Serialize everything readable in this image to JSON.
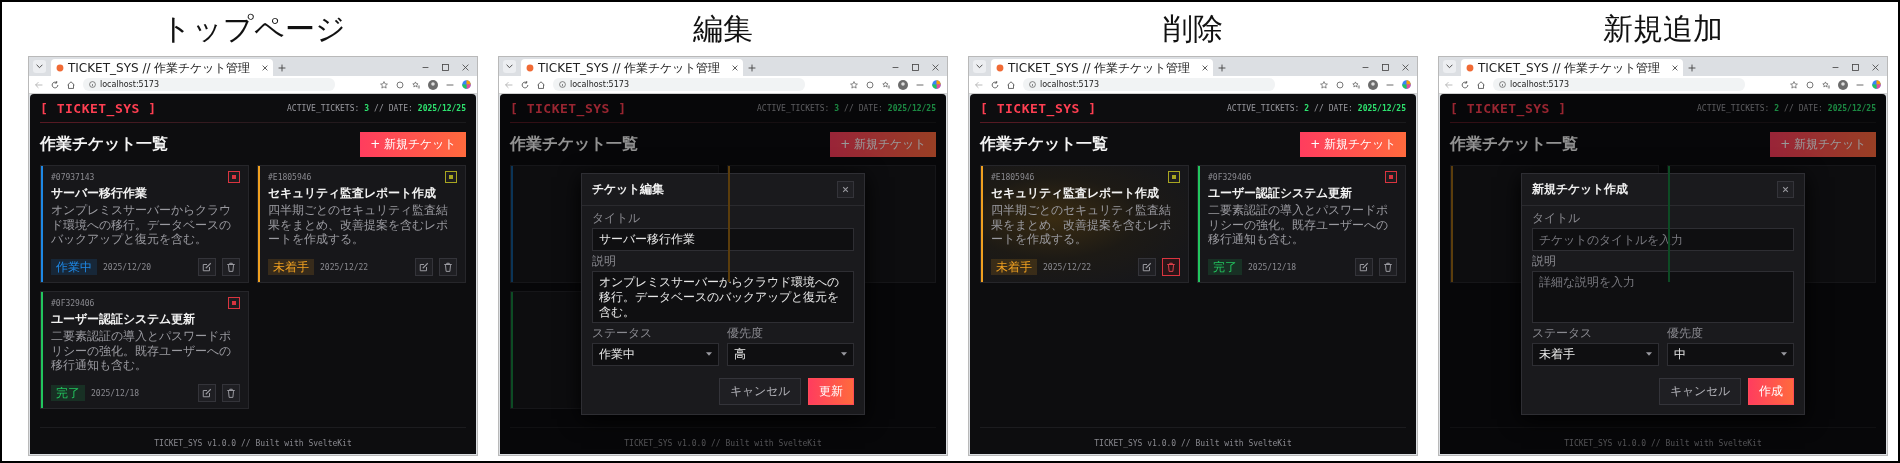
{
  "sections": [
    {
      "caption": "トップページ",
      "browser": {
        "tab_title": "TICKET_SYS // 作業チケット管理",
        "url": "localhost:5173"
      },
      "page": {
        "logo": "[ TICKET_SYS ]",
        "stats": {
          "active_label": "ACTIVE_TICKETS:",
          "active_count": "3",
          "separator": "//",
          "date_label": "DATE:",
          "date": "2025/12/25"
        },
        "heading": "作業チケット一覧",
        "new_button": "+ 新規チケット",
        "cards": [
          {
            "kind": "ticket",
            "id": "#07937143",
            "priority_marker": {
              "color": "#d9343f"
            },
            "title": "サーバー移行作業",
            "description": "オンプレミスサーバーからクラウド環境への移行。データベースのバックアップと復元を含む。",
            "status": "作業中",
            "date": "2025/12/20",
            "color": "#1e88e5",
            "hovered": false
          },
          {
            "kind": "ticket",
            "id": "#E1805946",
            "priority_marker": {
              "color": "#a8a520"
            },
            "title": "セキュリティ監査レポート作成",
            "description": "四半期ごとのセキュリティ監査結果をまとめ、改善提案を含むレポートを作成する。",
            "status": "未着手",
            "date": "2025/12/22",
            "color": "#f0a020",
            "hovered": false
          },
          {
            "kind": "ticket",
            "id": "#0F329406",
            "priority_marker": {
              "color": "#d9343f"
            },
            "title": "ユーザー認証システム更新",
            "description": "二要素認証の導入とパスワードポリシーの強化。既存ユーザーへの移行通知も含む。",
            "status": "完了",
            "date": "2025/12/18",
            "color": "#22c55e",
            "hovered": false
          }
        ],
        "footer": "TICKET_SYS v1.0.0 // Built with SvelteKit"
      }
    },
    {
      "caption": "編集",
      "browser": {
        "tab_title": "TICKET_SYS // 作業チケット管理",
        "url": "localhost:5173"
      },
      "page": {
        "logo": "[ TICKET_SYS ]",
        "stats": {
          "active_label": "ACTIVE_TICKETS:",
          "active_count": "3",
          "separator": "//",
          "date_label": "DATE:",
          "date": "2025/12/25"
        },
        "heading": "作業チケット一覧",
        "new_button": "+ 新規チケット",
        "cards": [
          {
            "kind": "covered",
            "color": "#0b3457"
          },
          {
            "kind": "covered",
            "color": "#5b3d0c"
          },
          {
            "kind": "covered",
            "color": "#0d4b24"
          }
        ],
        "footer": "TICKET_SYS v1.0.0 // Built with SvelteKit"
      },
      "modal": {
        "title": "チケット編集",
        "fields": [
          {
            "kind": "text",
            "label": "タイトル",
            "value": "サーバー移行作業"
          },
          {
            "kind": "textarea",
            "label": "説明",
            "value": "オンプレミスサーバーからクラウド環境への移行。データベースのバックアップと復元を含む。"
          },
          {
            "kind": "select",
            "label": "ステータス",
            "value": "作業中"
          },
          {
            "kind": "select",
            "label": "優先度",
            "value": "高"
          }
        ],
        "buttons": [
          {
            "kind": "secondary",
            "label": "キャンセル"
          },
          {
            "kind": "primary",
            "label": "更新"
          }
        ]
      }
    },
    {
      "caption": "削除",
      "browser": {
        "tab_title": "TICKET_SYS // 作業チケット管理",
        "url": "localhost:5173"
      },
      "page": {
        "logo": "[ TICKET_SYS ]",
        "stats": {
          "active_label": "ACTIVE_TICKETS:",
          "active_count": "2",
          "separator": "//",
          "date_label": "DATE:",
          "date": "2025/12/25"
        },
        "heading": "作業チケット一覧",
        "new_button": "+ 新規チケット",
        "cards": [
          {
            "kind": "ticket",
            "id": "#E1805946",
            "priority_marker": {
              "color": "#a8a520"
            },
            "title": "セキュリティ監査レポート作成",
            "description": "四半期ごとのセキュリティ監査結果をまとめ、改善提案を含むレポートを作成する。",
            "status": "未着手",
            "date": "2025/12/22",
            "color": "#f0a020",
            "hovered": true
          },
          {
            "kind": "ticket",
            "id": "#0F329406",
            "priority_marker": {
              "color": "#d9343f"
            },
            "title": "ユーザー認証システム更新",
            "description": "二要素認証の導入とパスワードポリシーの強化。既存ユーザーへの移行通知も含む。",
            "status": "完了",
            "date": "2025/12/18",
            "color": "#22c55e",
            "hovered": false
          }
        ],
        "footer": "TICKET_SYS v1.0.0 // Built with SvelteKit"
      }
    },
    {
      "caption": "新規追加",
      "browser": {
        "tab_title": "TICKET_SYS // 作業チケット管理",
        "url": "localhost:5173"
      },
      "page": {
        "logo": "[ TICKET_SYS ]",
        "stats": {
          "active_label": "ACTIVE_TICKETS:",
          "active_count": "2",
          "separator": "//",
          "date_label": "DATE:",
          "date": "2025/12/25"
        },
        "heading": "作業チケット一覧",
        "new_button": "+ 新規チケット",
        "cards": [
          {
            "kind": "covered",
            "color": "#5b3d0c"
          },
          {
            "kind": "covered",
            "color": "#0d4b24"
          }
        ],
        "footer": "TICKET_SYS v1.0.0 // Built with SvelteKit"
      },
      "modal": {
        "title": "新規チケット作成",
        "fields": [
          {
            "kind": "text",
            "label": "タイトル",
            "placeholder": "チケットのタイトルを入力"
          },
          {
            "kind": "textarea",
            "label": "説明",
            "placeholder": "詳細な説明を入力"
          },
          {
            "kind": "select",
            "label": "ステータス",
            "value": "未着手"
          },
          {
            "kind": "select",
            "label": "優先度",
            "value": "中"
          }
        ],
        "buttons": [
          {
            "kind": "secondary",
            "label": "キャンセル"
          },
          {
            "kind": "primary",
            "label": "作成"
          }
        ]
      }
    }
  ]
}
